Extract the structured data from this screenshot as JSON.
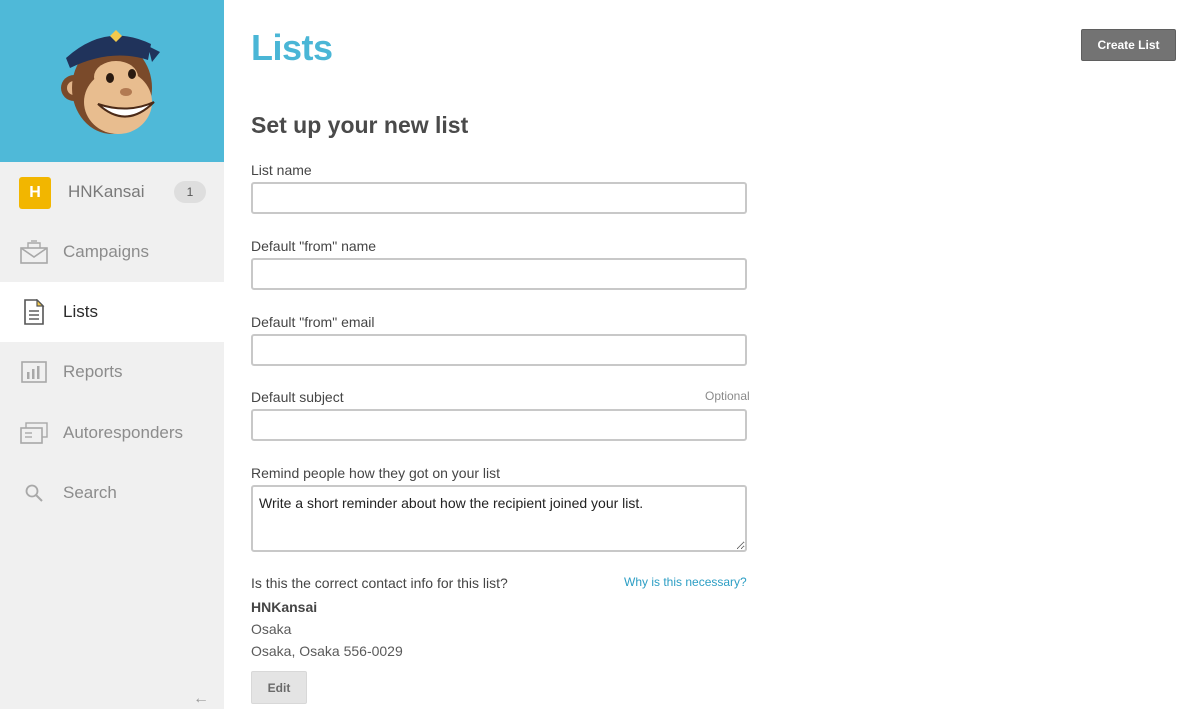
{
  "brand": {
    "accent": "#4fb9d8",
    "title_color": "#4ab6d6",
    "avatar_color": "#f2b600"
  },
  "sidebar": {
    "logo_icon": "chimp-logo-icon",
    "account": {
      "initial": "H",
      "name": "HNKansai",
      "badge": "1"
    },
    "items": [
      {
        "label": "Campaigns",
        "icon": "envelope-icon",
        "active": false
      },
      {
        "label": "Lists",
        "icon": "document-icon",
        "active": true
      },
      {
        "label": "Reports",
        "icon": "bar-chart-icon",
        "active": false
      },
      {
        "label": "Autoresponders",
        "icon": "stacked-mail-icon",
        "active": false
      },
      {
        "label": "Search",
        "icon": "search-icon",
        "active": false
      }
    ],
    "collapse": "←"
  },
  "header": {
    "title": "Lists",
    "create_button": "Create List"
  },
  "form": {
    "section_title": "Set up your new list",
    "fields": {
      "list_name": {
        "label": "List name",
        "value": ""
      },
      "from_name": {
        "label": "Default \"from\" name",
        "value": ""
      },
      "from_email": {
        "label": "Default \"from\" email",
        "value": ""
      },
      "subject": {
        "label": "Default subject",
        "value": "",
        "optional": "Optional"
      },
      "reminder": {
        "label": "Remind people how they got on your list",
        "value": "Write a short reminder about how the recipient joined your list."
      }
    },
    "contact": {
      "question": "Is this the correct contact info for this list?",
      "why_link": "Why is this necessary?",
      "name": "HNKansai",
      "line1": "Osaka",
      "line2": "Osaka, Osaka 556-0029",
      "edit_button": "Edit"
    }
  }
}
